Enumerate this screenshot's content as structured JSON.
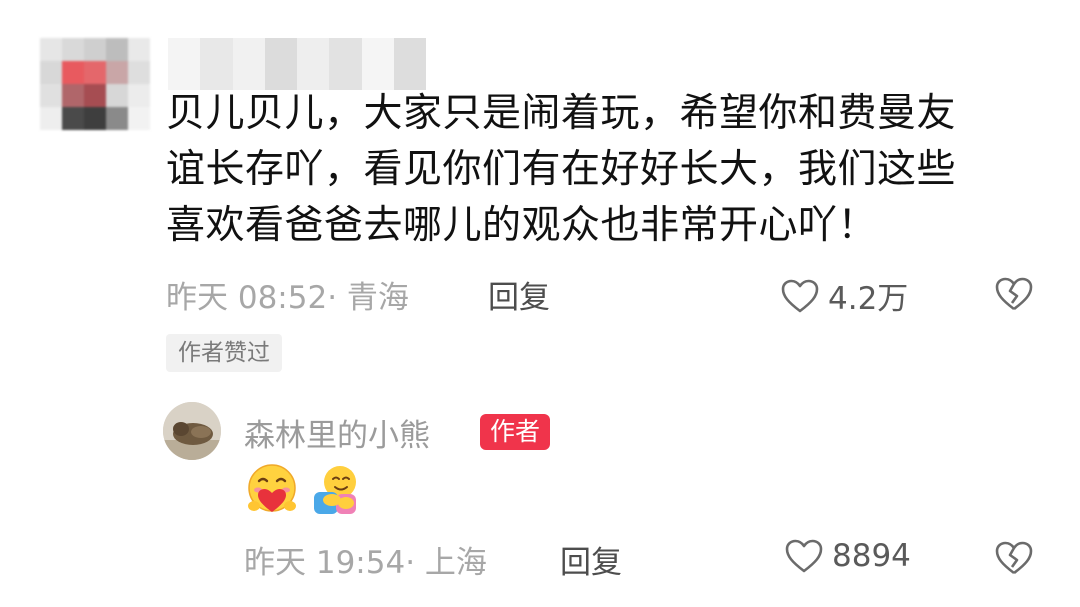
{
  "comment": {
    "text_lines": [
      "贝儿贝儿，大家只是闹着玩，希望你和费曼友",
      "谊长存吖，看见你们有在好好长大，我们这些",
      "喜欢看爸爸去哪儿的观众也非常开心吖！"
    ],
    "time": "昨天 08:52",
    "location": "· 青海",
    "reply_label": "回复",
    "likes": "4.2万",
    "author_liked_badge": "作者赞过"
  },
  "reply": {
    "username": "森林里的小熊",
    "author_badge": "作者",
    "emojis": [
      "heart-hug-emoji",
      "hugging-emoji"
    ],
    "time": "昨天 19:54",
    "location": "· 上海",
    "reply_label": "回复",
    "likes": "8894"
  },
  "colors": {
    "author_badge_bg": "#f0344b",
    "meta_text": "#a7a7a7",
    "comment_text": "#111111"
  }
}
